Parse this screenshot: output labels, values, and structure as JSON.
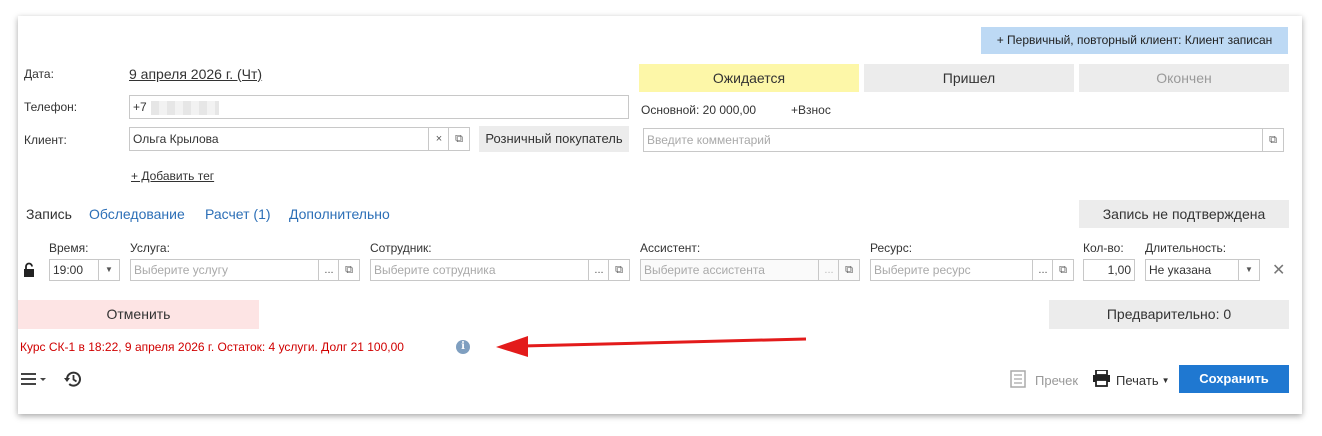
{
  "client_type_badge": "+ Первичный, повторный клиент: Клиент записан",
  "date": {
    "label": "Дата:",
    "value": "9 апреля 2026 г. (Чт)"
  },
  "phone": {
    "label": "Телефон:",
    "value": "+7"
  },
  "client": {
    "label": "Клиент:",
    "value": "Ольга Крылова",
    "clear": "×",
    "retail_button": "Розничный покупатель"
  },
  "add_tag": "+ Добавить тег",
  "status": {
    "waiting": "Ожидается",
    "arrived": "Пришел",
    "finished": "Окончен"
  },
  "balance": {
    "main": "Основной: 20 000,00",
    "deposit": "+Взнос"
  },
  "comment_placeholder": "Введите комментарий",
  "tabs": [
    "Запись",
    "Обследование",
    "Расчет (1)",
    "Дополнительно"
  ],
  "confirm_button": "Запись не подтверждена",
  "row": {
    "time_label": "Время:",
    "time_value": "19:00",
    "service_label": "Услуга:",
    "service_placeholder": "Выберите услугу",
    "employee_label": "Сотрудник:",
    "employee_placeholder": "Выберите сотрудника",
    "assistant_label": "Ассистент:",
    "assistant_placeholder": "Выберите ассистента",
    "resource_label": "Ресурс:",
    "resource_placeholder": "Выберите ресурс",
    "qty_label": "Кол-во:",
    "qty_value": "1,00",
    "duration_label": "Длительность:",
    "duration_value": "Не указана",
    "dots": "...",
    "open": "⧉",
    "close": "✕"
  },
  "cancel_button": "Отменить",
  "preliminary_button": "Предварительно: 0",
  "course_info": "Курс СК-1 в 18:22, 9 апреля 2026 г. Остаток: 4 услуги. Долг 21 100,00",
  "footer": {
    "receipt": "Пречек",
    "print": "Печать",
    "save": "Сохранить"
  },
  "colors": {
    "accent": "#1f78d1",
    "waiting": "#fdf7a8",
    "cancel": "#fde4e4",
    "badge": "#bdd9f4",
    "alert": "#d00000"
  }
}
